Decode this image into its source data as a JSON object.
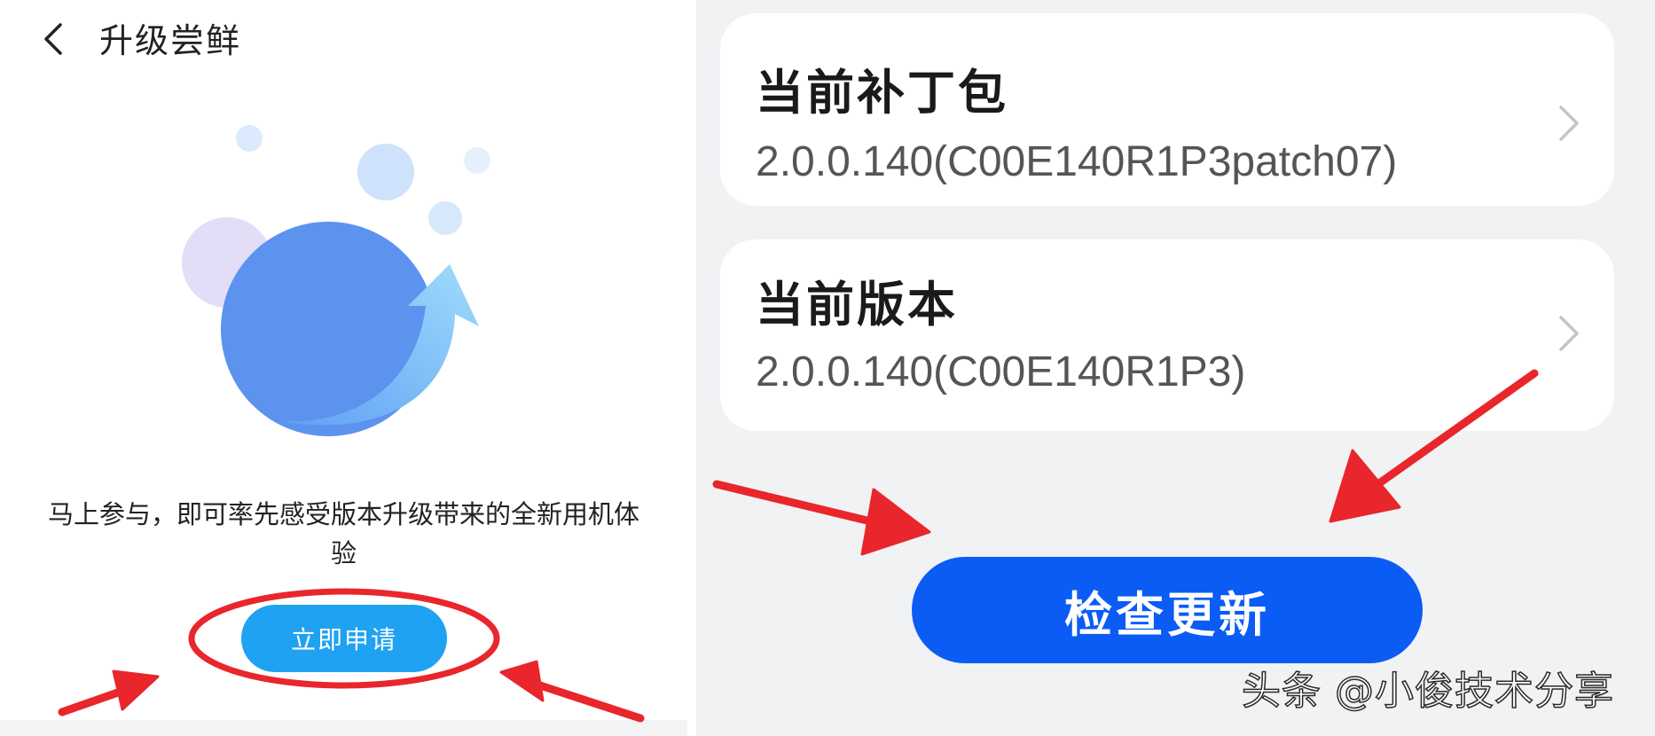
{
  "left_screen": {
    "title": "升级尝鲜",
    "intro_text": "马上参与，即可率先感受版本升级带来的全新用机体验",
    "apply_button_label": "立即申请"
  },
  "right_screen": {
    "patch_card": {
      "title": "当前补丁包",
      "value": "2.0.0.140(C00E140R1P3patch07)"
    },
    "version_card": {
      "title": "当前版本",
      "value": "2.0.0.140(C00E140R1P3)"
    },
    "check_update_label": "检查更新"
  },
  "watermark": "头条 @小俊技术分享",
  "colors": {
    "apply_button": "#1fa2f2",
    "check_update_button": "#0b5cf5",
    "annotation_red": "#e8262b",
    "right_background": "#f1f2f4"
  },
  "icons": [
    "back-arrow-icon",
    "chevron-right-icon",
    "upgrade-illustration"
  ]
}
